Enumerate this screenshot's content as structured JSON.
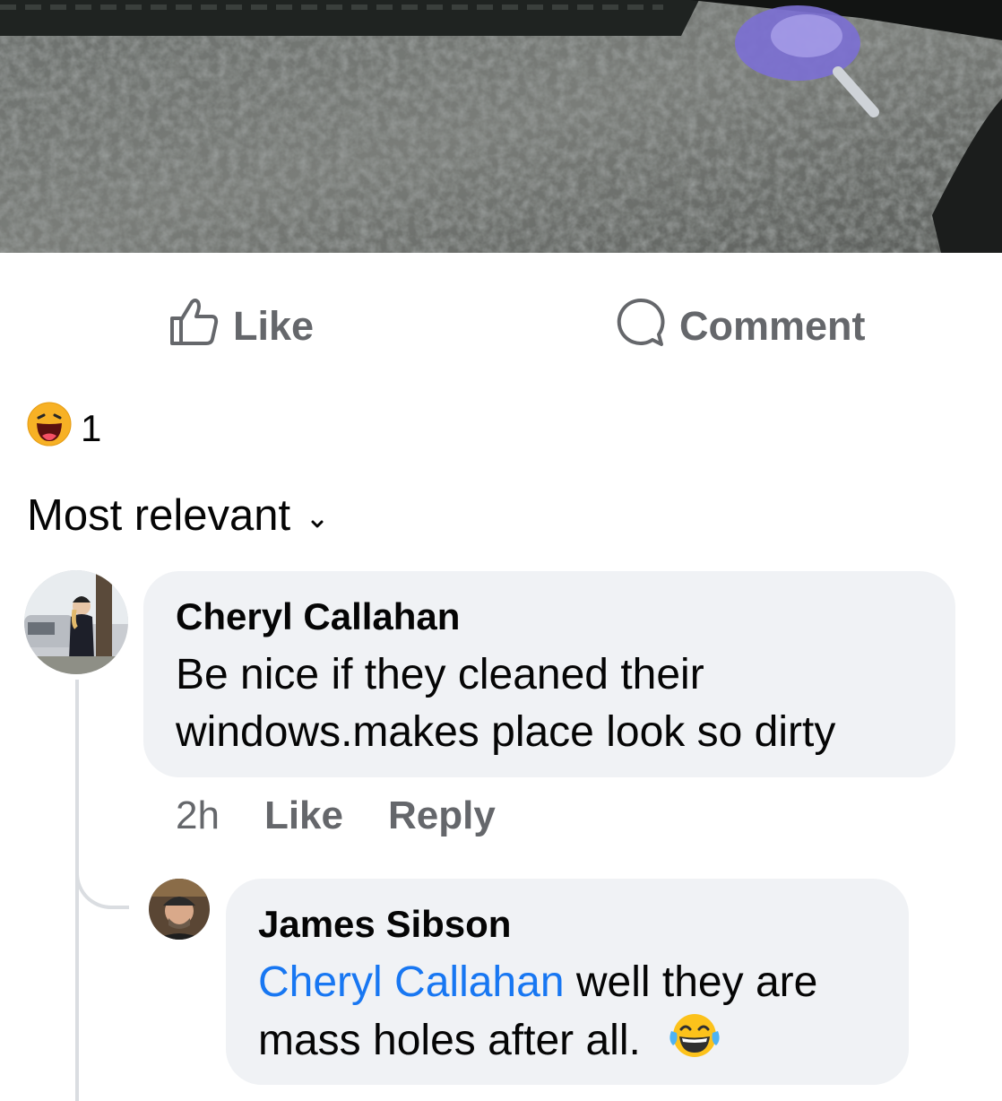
{
  "post": {
    "photo_icon": "concrete-sidewalk-photo",
    "actions": {
      "like_label": "Like",
      "comment_label": "Comment"
    },
    "reactions": {
      "icon": "haha-emoji",
      "count": "1"
    }
  },
  "comments_sort": {
    "label": "Most relevant",
    "icon": "chevron-down-icon"
  },
  "comments": [
    {
      "author": "Cheryl Callahan",
      "text": "Be nice if they cleaned their windows.makes place look so dirty",
      "time": "2h",
      "like_label": "Like",
      "reply_label": "Reply"
    }
  ],
  "replies": [
    {
      "author": "James Sibson",
      "mention": "Cheryl Callahan",
      "text_line1": " well they are",
      "text_line2": "mass holes after all.",
      "emoji": "tears-of-joy-emoji"
    }
  ],
  "colors": {
    "link": "#1877f2",
    "muted": "#65676b",
    "bubble": "#f0f2f5"
  }
}
